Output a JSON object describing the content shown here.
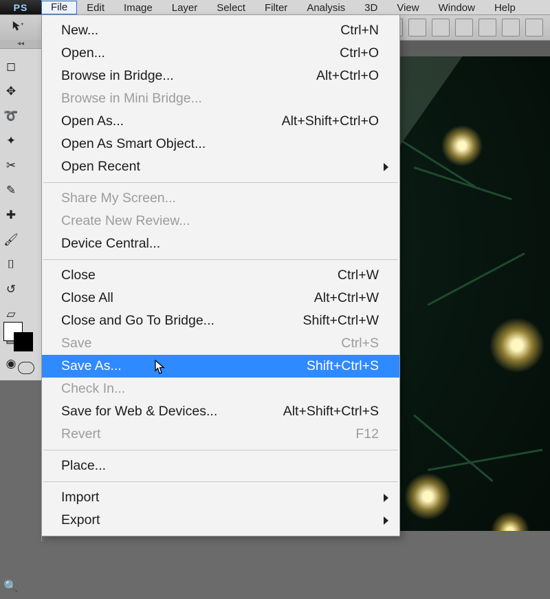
{
  "app_badge": "PS",
  "menubar": {
    "items": [
      {
        "label": "File",
        "active": true
      },
      {
        "label": "Edit",
        "active": false
      },
      {
        "label": "Image",
        "active": false
      },
      {
        "label": "Layer",
        "active": false
      },
      {
        "label": "Select",
        "active": false
      },
      {
        "label": "Filter",
        "active": false
      },
      {
        "label": "Analysis",
        "active": false
      },
      {
        "label": "3D",
        "active": false
      },
      {
        "label": "View",
        "active": false
      },
      {
        "label": "Window",
        "active": false
      },
      {
        "label": "Help",
        "active": false
      }
    ]
  },
  "file_menu": {
    "groups": [
      [
        {
          "label": "New...",
          "shortcut": "Ctrl+N",
          "enabled": true,
          "submenu": false,
          "selected": false
        },
        {
          "label": "Open...",
          "shortcut": "Ctrl+O",
          "enabled": true,
          "submenu": false,
          "selected": false
        },
        {
          "label": "Browse in Bridge...",
          "shortcut": "Alt+Ctrl+O",
          "enabled": true,
          "submenu": false,
          "selected": false
        },
        {
          "label": "Browse in Mini Bridge...",
          "shortcut": "",
          "enabled": false,
          "submenu": false,
          "selected": false
        },
        {
          "label": "Open As...",
          "shortcut": "Alt+Shift+Ctrl+O",
          "enabled": true,
          "submenu": false,
          "selected": false
        },
        {
          "label": "Open As Smart Object...",
          "shortcut": "",
          "enabled": true,
          "submenu": false,
          "selected": false
        },
        {
          "label": "Open Recent",
          "shortcut": "",
          "enabled": true,
          "submenu": true,
          "selected": false
        }
      ],
      [
        {
          "label": "Share My Screen...",
          "shortcut": "",
          "enabled": false,
          "submenu": false,
          "selected": false
        },
        {
          "label": "Create New Review...",
          "shortcut": "",
          "enabled": false,
          "submenu": false,
          "selected": false
        },
        {
          "label": "Device Central...",
          "shortcut": "",
          "enabled": true,
          "submenu": false,
          "selected": false
        }
      ],
      [
        {
          "label": "Close",
          "shortcut": "Ctrl+W",
          "enabled": true,
          "submenu": false,
          "selected": false
        },
        {
          "label": "Close All",
          "shortcut": "Alt+Ctrl+W",
          "enabled": true,
          "submenu": false,
          "selected": false
        },
        {
          "label": "Close and Go To Bridge...",
          "shortcut": "Shift+Ctrl+W",
          "enabled": true,
          "submenu": false,
          "selected": false
        },
        {
          "label": "Save",
          "shortcut": "Ctrl+S",
          "enabled": false,
          "submenu": false,
          "selected": false
        },
        {
          "label": "Save As...",
          "shortcut": "Shift+Ctrl+S",
          "enabled": true,
          "submenu": false,
          "selected": true
        },
        {
          "label": "Check In...",
          "shortcut": "",
          "enabled": false,
          "submenu": false,
          "selected": false
        },
        {
          "label": "Save for Web & Devices...",
          "shortcut": "Alt+Shift+Ctrl+S",
          "enabled": true,
          "submenu": false,
          "selected": false
        },
        {
          "label": "Revert",
          "shortcut": "F12",
          "enabled": false,
          "submenu": false,
          "selected": false
        }
      ],
      [
        {
          "label": "Place...",
          "shortcut": "",
          "enabled": true,
          "submenu": false,
          "selected": false
        }
      ],
      [
        {
          "label": "Import",
          "shortcut": "",
          "enabled": true,
          "submenu": true,
          "selected": false
        },
        {
          "label": "Export",
          "shortcut": "",
          "enabled": true,
          "submenu": true,
          "selected": false
        }
      ]
    ]
  },
  "tools": [
    "marquee",
    "move-behind",
    "lasso",
    "quick-select",
    "crop",
    "eyedropper",
    "healing",
    "brush",
    "stamp",
    "history-brush",
    "eraser",
    "gradient",
    "blur",
    "dodge",
    "pen",
    "type",
    "path-select",
    "shape",
    "3d",
    "hand",
    "rotate",
    "zoom"
  ],
  "options_bar_icons": [
    "align-left",
    "align-center",
    "align-right",
    "dist-top",
    "dist-vcenter",
    "dist-bottom",
    "more"
  ],
  "canvas_subject": "christmas-tree-bokeh-photo"
}
